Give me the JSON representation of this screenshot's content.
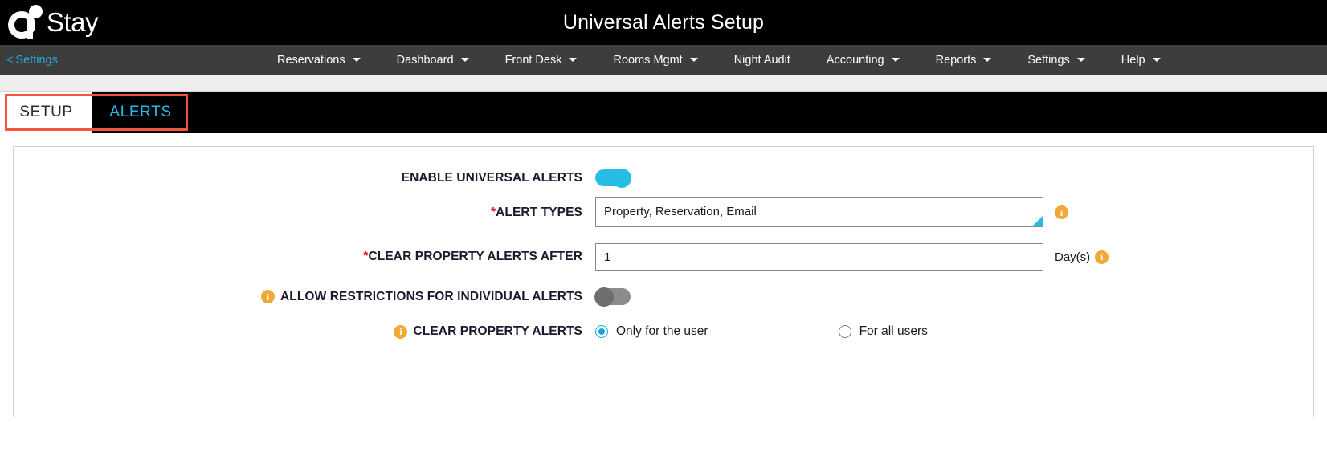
{
  "header": {
    "logo_text": "Stay",
    "logo_icon": "e-stay-logo-icon",
    "title": "Universal Alerts Setup"
  },
  "nav": {
    "back_label": "Settings",
    "back_chevron": "<",
    "items": [
      {
        "label": "Reservations",
        "has_caret": true
      },
      {
        "label": "Dashboard",
        "has_caret": true
      },
      {
        "label": "Front Desk",
        "has_caret": true
      },
      {
        "label": "Rooms Mgmt",
        "has_caret": true
      },
      {
        "label": "Night Audit",
        "has_caret": false
      },
      {
        "label": "Accounting",
        "has_caret": true
      },
      {
        "label": "Reports",
        "has_caret": true
      },
      {
        "label": "Settings",
        "has_caret": true
      },
      {
        "label": "Help",
        "has_caret": true
      }
    ]
  },
  "tabs": [
    {
      "label": "SETUP",
      "active": false
    },
    {
      "label": "ALERTS",
      "active": true
    }
  ],
  "form": {
    "enable_alerts": {
      "label": "ENABLE UNIVERSAL ALERTS",
      "state": "on"
    },
    "alert_types": {
      "required_marker": "*",
      "label": "ALERT TYPES",
      "value": "Property, Reservation, Email",
      "info": "i"
    },
    "clear_after": {
      "required_marker": "*",
      "label": "CLEAR PROPERTY ALERTS AFTER",
      "value": "1",
      "unit": "Day(s)",
      "info": "i"
    },
    "allow_restrictions": {
      "info": "i",
      "label": "ALLOW RESTRICTIONS FOR INDIVIDUAL ALERTS",
      "state": "off"
    },
    "clear_property_alerts": {
      "info": "i",
      "label": "CLEAR PROPERTY ALERTS",
      "options": [
        {
          "label": "Only for the user",
          "selected": true
        },
        {
          "label": "For all users",
          "selected": false
        }
      ]
    }
  },
  "colors": {
    "accent_cyan": "#29b8e8",
    "toggle_on": "#27bde2",
    "toggle_off": "#8b8b8b",
    "info_orange": "#f0a934",
    "required_red": "#e8152b",
    "highlight_red": "#f4543c",
    "nav_bg": "#3d3d3d",
    "header_bg": "#000000"
  }
}
